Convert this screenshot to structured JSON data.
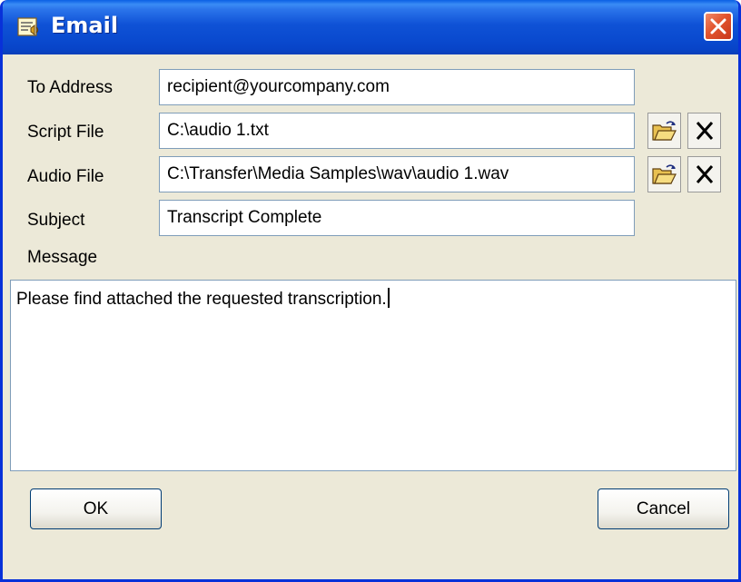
{
  "window": {
    "title": "Email",
    "icon": "email-app-icon",
    "close_icon": "close-icon"
  },
  "form": {
    "to_address": {
      "label": "To Address",
      "value": "recipient@yourcompany.com"
    },
    "script_file": {
      "label": "Script File",
      "value": "C:\\audio 1.txt"
    },
    "audio_file": {
      "label": "Audio File",
      "value": "C:\\Transfer\\Media Samples\\wav\\audio 1.wav"
    },
    "subject": {
      "label": "Subject",
      "value": "Transcript Complete"
    },
    "message": {
      "label": "Message",
      "value": "Please find attached the requested transcription."
    }
  },
  "buttons": {
    "ok": "OK",
    "cancel": "Cancel"
  },
  "icons": {
    "browse": "open-folder-icon",
    "clear": "clear-x-icon"
  },
  "colors": {
    "titlebar": "#0a4bd0",
    "window_bg": "#ece9d8",
    "close_button": "#e2542e",
    "field_border": "#7f9db9"
  }
}
